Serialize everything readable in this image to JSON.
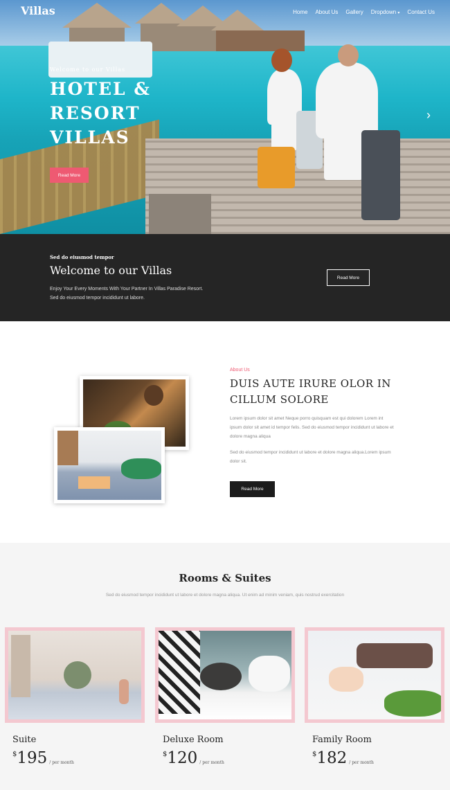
{
  "nav": {
    "logo": "Villas",
    "items": [
      "Home",
      "About Us",
      "Gallery",
      "Dropdown",
      "Contact Us"
    ]
  },
  "hero": {
    "kicker": "Welcome to our Villas",
    "title_line1": "HOTEL &",
    "title_line2": "RESORT",
    "title_line3": "VILLAS",
    "button": "Read More"
  },
  "welcome": {
    "kicker": "Sed do eiusmod tempor",
    "title": "Welcome to our Villas",
    "line1": "Enjoy Your Every Moments With Your Partner In Villas Paradise Resort.",
    "line2": "Sed do eiusmod tempor incididunt ut labore.",
    "button": "Read More"
  },
  "about": {
    "kicker": "About Us",
    "title": "DUIS AUTE IRURE OLOR IN CILLUM SOLORE",
    "p1": "Lorem ipsum dolor sit amet Neque porro quisquam est qui dolorem Lorem int ipsum dolor sit amet id tempor felis. Sed do eiusmod tempor incididunt ut labore et dolore magna aliqua",
    "p2": "Sed do eiusmod tempor incididunt ut labore et dolore magna aliqua.Lorem ipsum dolor sit.",
    "button": "Read More"
  },
  "rooms": {
    "title": "Rooms & Suites",
    "subtitle": "Sed do eiusmod tempor incididunt ut labore et dolore magna aliqua. Ut enim ad minim veniam, quis nostrud exercitation",
    "cards": [
      {
        "name": "Suite",
        "currency": "$",
        "price": "195",
        "period": "/ per month"
      },
      {
        "name": "Deluxe Room",
        "currency": "$",
        "price": "120",
        "period": "/ per month"
      },
      {
        "name": "Family Room",
        "currency": "$",
        "price": "182",
        "period": "/ per month"
      }
    ]
  },
  "colors": {
    "accent": "#ee5a72",
    "dark": "#252525",
    "card_border": "#f4c8d0"
  }
}
